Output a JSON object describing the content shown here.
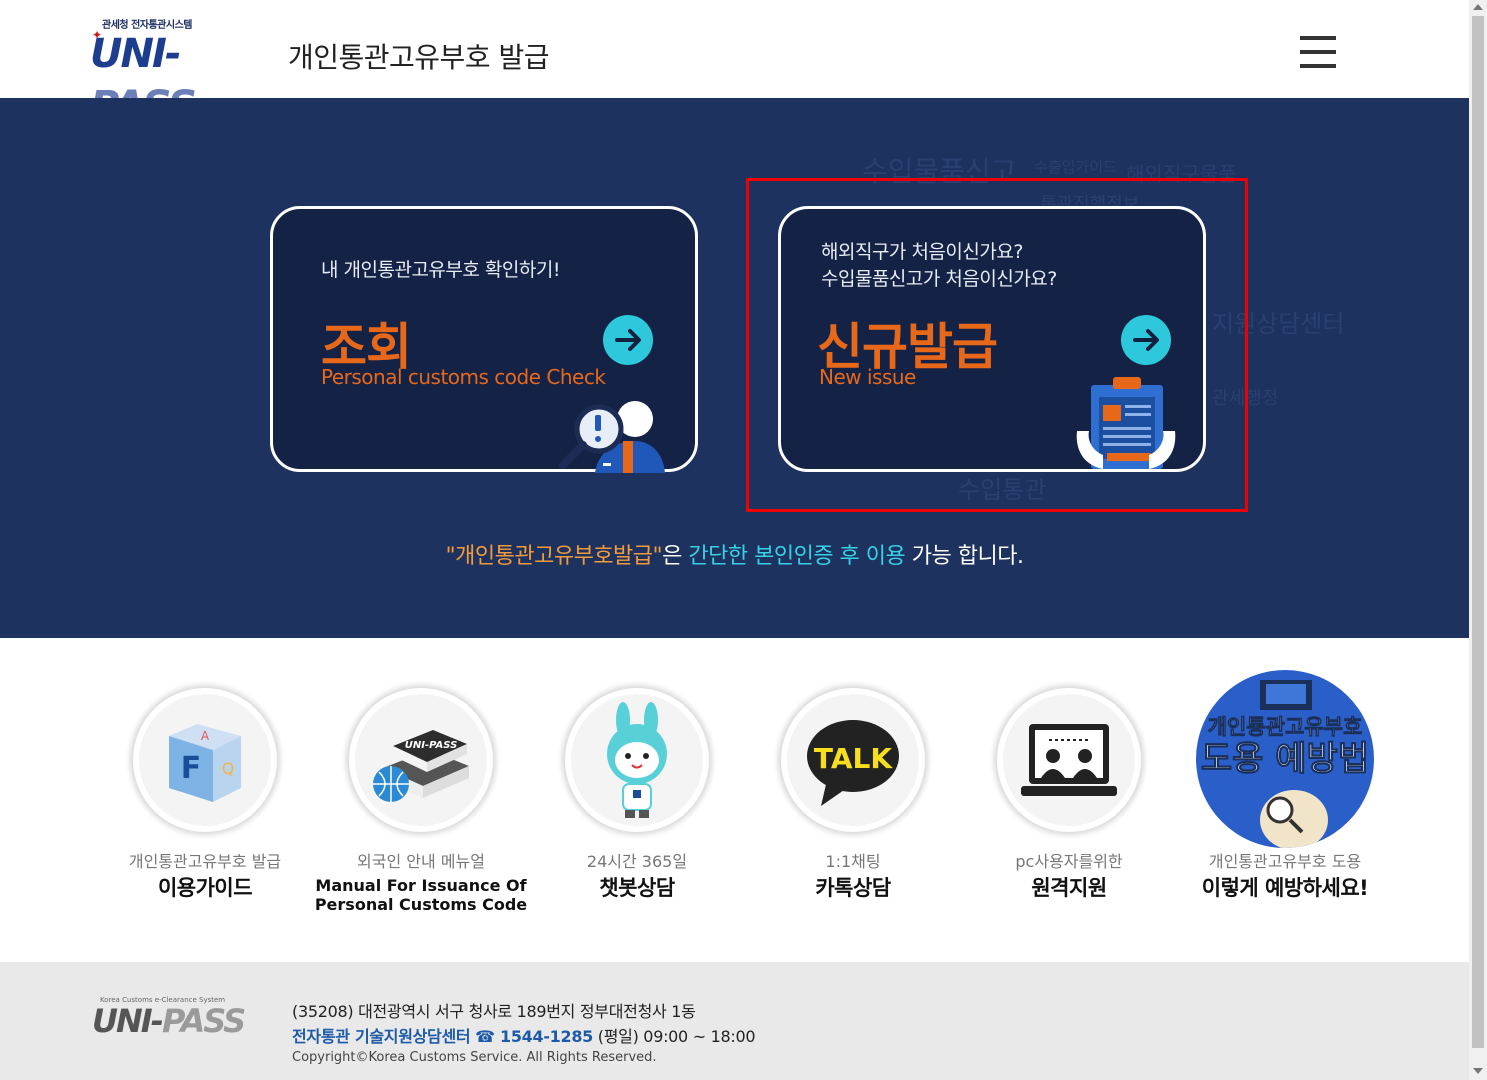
{
  "header": {
    "logo_sub": "관세청 전자통관시스템",
    "logo_text_a": "UNI-",
    "logo_text_b": "PASS",
    "title": "개인통관고유부호 발급",
    "menu_icon": "hamburger-menu-icon"
  },
  "hero": {
    "bg_words": [
      "수입물품신고",
      "수출입가이드",
      "해외직구물품",
      "통관진행정보",
      "지원상담센터",
      "관세행정",
      "수입통관"
    ],
    "check_card": {
      "question": "내 개인통관고유부호 확인하기!",
      "title": "조회",
      "subtitle": "Personal customs code Check",
      "icon": "magnifier-person-icon",
      "arrow_icon": "arrow-right-icon"
    },
    "issue_card": {
      "question_1": "해외직구가 처음이신가요?",
      "question_2": "수입물품신고가 처음이신가요?",
      "title": "신규발급",
      "subtitle": "New issue",
      "icon": "clipboard-hands-icon",
      "arrow_icon": "arrow-right-icon"
    },
    "notice": {
      "part1": "\"개인통관고유부호발급\"",
      "part2": "은 ",
      "part3": "간단한 본인인증 후 이용",
      "part4": " 가능 합니다."
    }
  },
  "icons": [
    {
      "small": "개인통관고유부호 발급",
      "big": "이용가이드",
      "icon": "faq-cube-icon"
    },
    {
      "small": "외국인 안내 메뉴얼",
      "big_line1": "Manual For Issuance Of",
      "big_line2": "Personal Customs Code",
      "icon": "manual-books-icon",
      "book_label": "UNI-PASS"
    },
    {
      "small": "24시간 365일",
      "big": "챗봇상담",
      "icon": "chatbot-rabbit-icon"
    },
    {
      "small": "1:1채팅",
      "big": "카톡상담",
      "icon": "kakaotalk-icon",
      "badge": "TALK"
    },
    {
      "small": "pc사용자를위한",
      "big": "원격지원",
      "icon": "remote-support-laptop-icon"
    },
    {
      "small": "개인통관고유부호 도용",
      "big": "이렇게 예방하세요!",
      "icon": "theft-prevention-icon",
      "badge_line1": "개인통관고유부호",
      "badge_line2": "도용 예방법"
    }
  ],
  "footer": {
    "logo_top": "Korea Customs e-Clearance System",
    "logo_a": "UNI-",
    "logo_b": "PASS",
    "address": "(35208) 대전광역시 서구 청사로 189번지 정부대전청사 1동",
    "help_center": "전자통관 기술지원상담센터",
    "phone_icon": "phone-icon",
    "phone": "☎ 1544-1285",
    "hours": " (평일) 09:00 ~ 18:00",
    "copyright": "Copyright©Korea Customs Service. All Rights Reserved."
  },
  "colors": {
    "hero_bg": "#1d325f",
    "card_bg": "#142246",
    "accent_orange": "#e8681a",
    "accent_cyan": "#2ec8dd",
    "highlight_red": "#ee0000"
  }
}
